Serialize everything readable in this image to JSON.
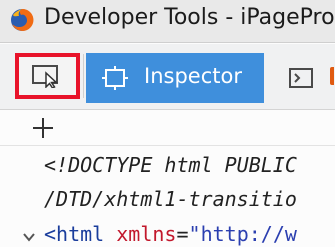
{
  "window": {
    "title": "Developer Tools - iPagePro"
  },
  "toolbar": {
    "tabs": [
      {
        "label": "Inspector",
        "icon": "inspector-icon",
        "active": true
      },
      {
        "label": "",
        "icon": "console-icon",
        "active": false
      }
    ]
  },
  "markup": {
    "doctype_line1": "<!DOCTYPE html PUBLIC",
    "doctype_line2": "/DTD/xhtml1-transitio",
    "html_tag_open": "<html",
    "html_attr_name": "xmlns",
    "html_attr_eq": "=",
    "html_attr_value": "\"http://w"
  },
  "colors": {
    "accent": "#3f8fdc",
    "highlight": "#e8132a",
    "tag": "#1a3d9c",
    "attr_name": "#c2182c",
    "attr_value": "#2b3fb0"
  }
}
